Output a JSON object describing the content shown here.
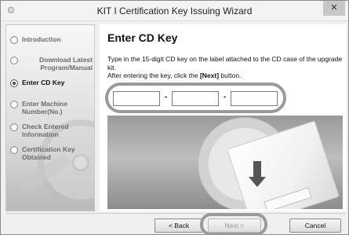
{
  "window": {
    "title": "KIT I Certification Key Issuing Wizard",
    "close_label": "✕"
  },
  "sidebar": {
    "steps": [
      {
        "label": "Introduction"
      },
      {
        "label": "Download Latest Program/Manual"
      },
      {
        "label": "Enter CD Key"
      },
      {
        "label": "Enter Machine Number(No.)"
      },
      {
        "label": "Check Entered Information"
      },
      {
        "label": "Certification Key Obtained"
      }
    ],
    "active_step": "Enter CD Key"
  },
  "main": {
    "heading": "Enter CD Key",
    "instruction_line1": "Type in the 15-digit CD key on the label attached to the CD case of the upgrade kit.",
    "instruction_line2_prefix": "After entering the key, click the ",
    "instruction_line2_bold": "[Next]",
    "instruction_line2_suffix": " button.",
    "key_fields": [
      {
        "value": "",
        "placeholder": ""
      },
      {
        "value": "",
        "placeholder": ""
      },
      {
        "value": "",
        "placeholder": ""
      }
    ],
    "separator": "-"
  },
  "buttons": {
    "back_label": "< Back",
    "next_label": "Next >",
    "cancel_label": "Cancel"
  },
  "icons": {
    "app": "app-icon",
    "close": "close-icon",
    "step_radio": "radio-icon"
  },
  "colors": {
    "highlight_ring": "#9a9a9a",
    "window_bg": "#f0f0f0"
  }
}
